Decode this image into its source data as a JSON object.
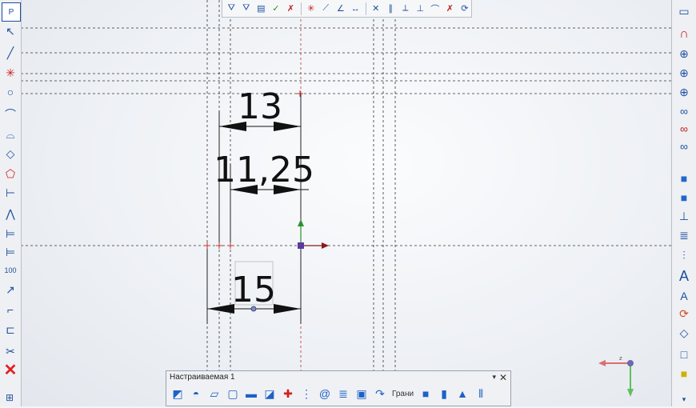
{
  "dimensions": {
    "dim_13": "13",
    "dim_1125": "11,25",
    "dim_15": "15"
  },
  "panel": {
    "title": "Настраиваемая 1",
    "menu_glyph": "▾",
    "close_glyph": "✕",
    "grani_label": "Грани"
  },
  "left_toolbar": [
    "parameters-icon",
    "pointer-icon",
    "line-icon",
    "point-icon",
    "circle-icon",
    "arc-icon",
    "fillet-icon",
    "rectangle-icon",
    "polygon-icon",
    "dimension-icon",
    "angular-dimension-icon",
    "linear-chain-icon",
    "baseline-dimension-icon",
    "leader-icon",
    "radial-dimension-icon",
    "ordinate-icon",
    "trim-icon",
    "delete-icon"
  ],
  "right_toolbar": [
    "window-icon",
    "magnet-icon",
    "zoom-icon",
    "zoom-window-icon",
    "zoom-all-icon",
    "glasses-icon",
    "glasses-red-icon",
    "glasses-green-icon",
    "cube-check-icon",
    "cube-check-red-icon",
    "align-icon",
    "spacing-icon",
    "distribute-icon",
    "text-icon",
    "text-small-icon",
    "rotate-icon",
    "plane-icon",
    "box-icon",
    "square-icon"
  ],
  "colors": {
    "axis_y": "#2f8f2f",
    "axis_x": "#8b1a1a",
    "origin": "#5b3aa0",
    "dimension_red_line": "#c03030"
  }
}
